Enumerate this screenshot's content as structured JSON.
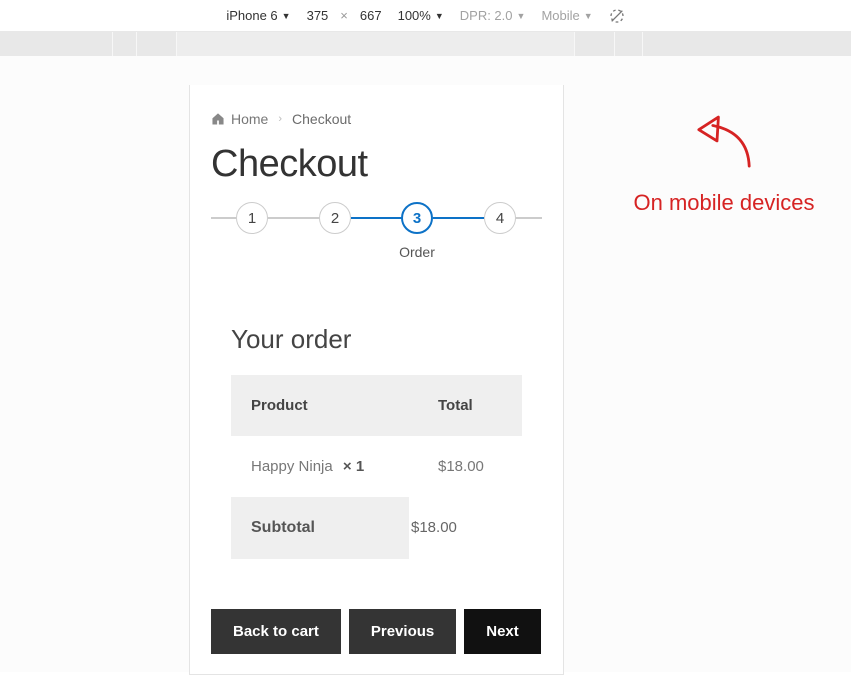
{
  "devtools": {
    "device": "iPhone 6",
    "width": "375",
    "height": "667",
    "sep": "×",
    "zoom": "100%",
    "dpr": "DPR: 2.0",
    "mobile": "Mobile"
  },
  "breadcrumb": {
    "home": "Home",
    "current": "Checkout"
  },
  "page_title": "Checkout",
  "stepper": {
    "s1": "1",
    "s2": "2",
    "s3": "3",
    "s4": "4",
    "active_label": "Order"
  },
  "order": {
    "heading": "Your order",
    "col_product": "Product",
    "col_total": "Total",
    "item_name": "Happy Ninja",
    "item_qty": "× 1",
    "item_total": "$18.00",
    "subtotal_label": "Subtotal",
    "subtotal_value": "$18.00"
  },
  "buttons": {
    "back": "Back to cart",
    "prev": "Previous",
    "next": "Next"
  },
  "annotation": "On mobile devices"
}
